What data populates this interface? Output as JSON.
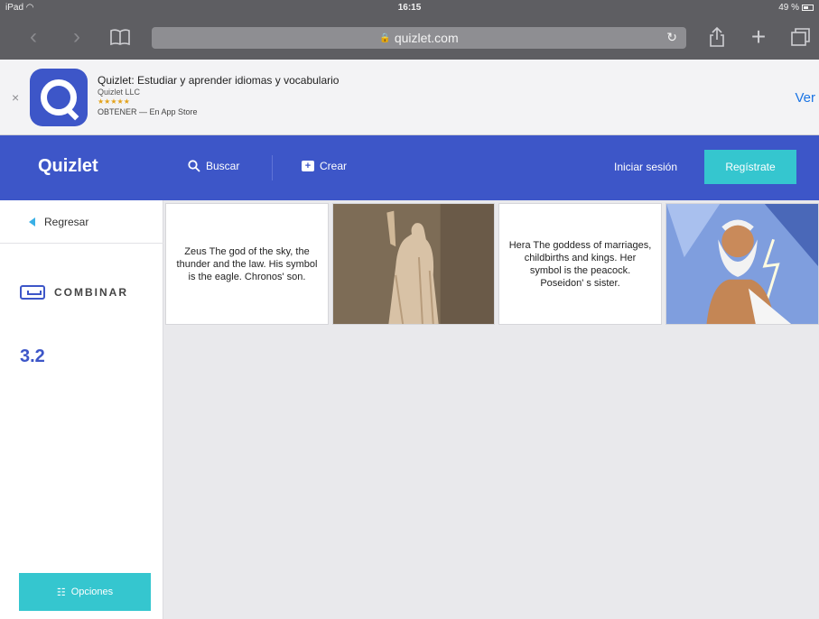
{
  "status": {
    "device": "iPad",
    "time": "16:15",
    "battery": "49 %"
  },
  "browser": {
    "url": "quizlet.com"
  },
  "banner": {
    "close": "×",
    "app_name": "Quizlet: Estudiar y aprender idiomas y vocabulario",
    "developer": "Quizlet LLC",
    "stars": "★★★★★",
    "store": "OBTENER — En App Store",
    "action": "Ver"
  },
  "header": {
    "logo": "Quizlet",
    "search": "Buscar",
    "create": "Crear",
    "login": "Iniciar sesión",
    "register": "Regístrate"
  },
  "sidebar": {
    "back": "Regresar",
    "mode": "COMBINAR",
    "timer": "3.2",
    "options": "Opciones"
  },
  "tiles": [
    {
      "type": "text",
      "text": "Zeus The god of the sky, the thunder and the law. His symbol is the eagle. Chronos' son."
    },
    {
      "type": "image",
      "icon": "statue-image"
    },
    {
      "type": "text",
      "text": "Hera The goddess of marriages, childbirths and kings. Her symbol is the peacock. Poseidon' s sister."
    },
    {
      "type": "image",
      "icon": "zeus-image"
    }
  ],
  "colors": {
    "brand": "#3d56c8",
    "accent": "#35c6cf"
  }
}
